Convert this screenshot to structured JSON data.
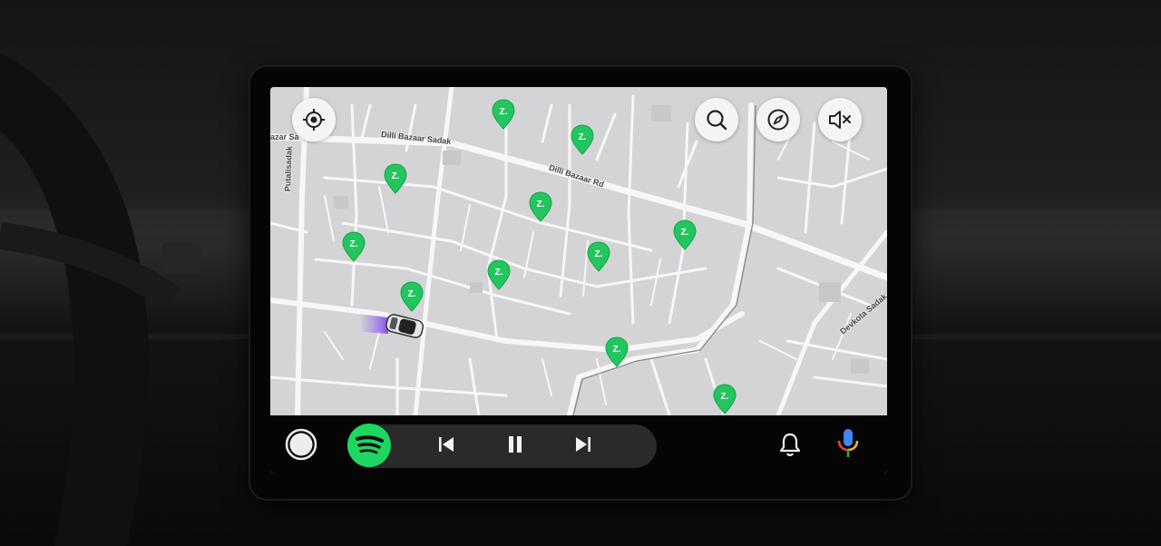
{
  "map": {
    "road_labels": {
      "dilli_bazaar_sadak": "Dilli Bazaar Sadak",
      "dilli_bazaar_rd": "Dilli Bazaar Rd",
      "putalisadak": "Putalisadak",
      "devkota_sadak": "Devkota Sadak",
      "azar_sa": "azar Sa"
    },
    "pin_glyph": "Z.",
    "pin_color": "#22c55e",
    "buttons": {
      "recenter_icon": "crosshair-locate-icon",
      "search_icon": "search-icon",
      "compass_icon": "compass-icon",
      "mute_icon": "volume-muted-icon"
    }
  },
  "dock": {
    "home_icon": "home-circle-icon",
    "media_app_icon": "spotify-icon",
    "media_app_color": "#1ed760",
    "controls": [
      "previous-track-icon",
      "pause-icon",
      "next-track-icon"
    ],
    "notification_icon": "bell-icon",
    "assistant_icon": "microphone-icon"
  }
}
